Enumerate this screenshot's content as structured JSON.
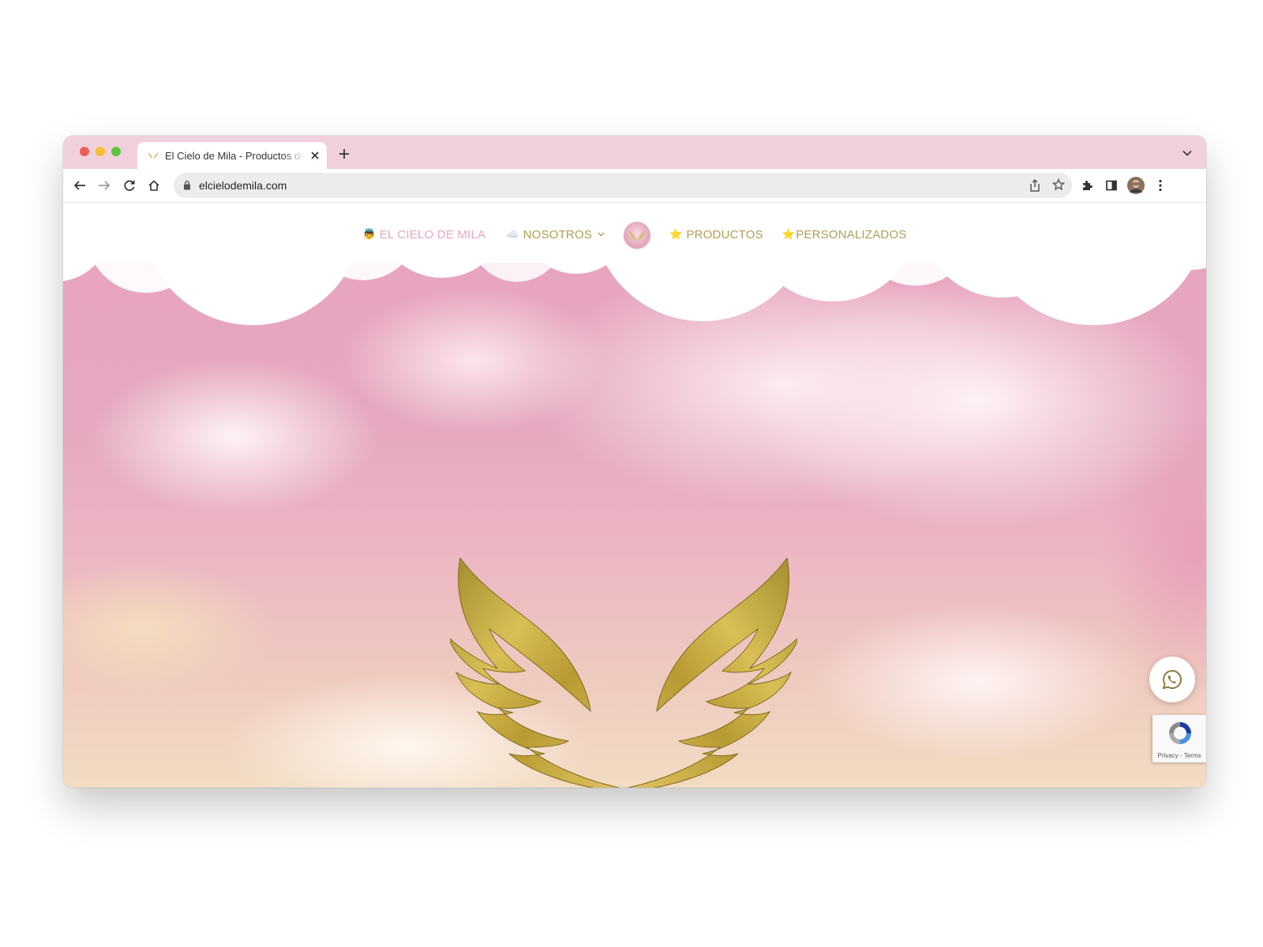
{
  "browser": {
    "tab_title": "El Cielo de Mila - Productos de",
    "url": "elcielodemila.com"
  },
  "nav": {
    "home_label": "EL CIELO DE MILA",
    "home_emoji": "👼",
    "nosotros_label": "NOSOTROS",
    "nosotros_emoji": "☁️",
    "productos_label": "PRODUCTOS",
    "productos_emoji": "⭐",
    "personalizados_label": "PERSONALIZADOS",
    "personalizados_emoji": "⭐"
  },
  "recaptcha": {
    "privacy": "Privacy",
    "separator": " - ",
    "terms": "Terms"
  },
  "colors": {
    "tabstrip": "#f0d0dc",
    "nav_pink": "#e7a6bd",
    "nav_gold": "#b19d55",
    "wing_gold": "#c9a83a",
    "whatsapp_icon": "#8c7a3e"
  },
  "icons": [
    "back-arrow-icon",
    "forward-arrow-icon",
    "reload-icon",
    "home-icon",
    "lock-icon",
    "share-icon",
    "bookmark-star-icon",
    "extensions-icon",
    "side-panel-icon",
    "profile-avatar-icon",
    "kebab-menu-icon",
    "whatsapp-icon",
    "recaptcha-icon",
    "chevron-down-icon"
  ]
}
